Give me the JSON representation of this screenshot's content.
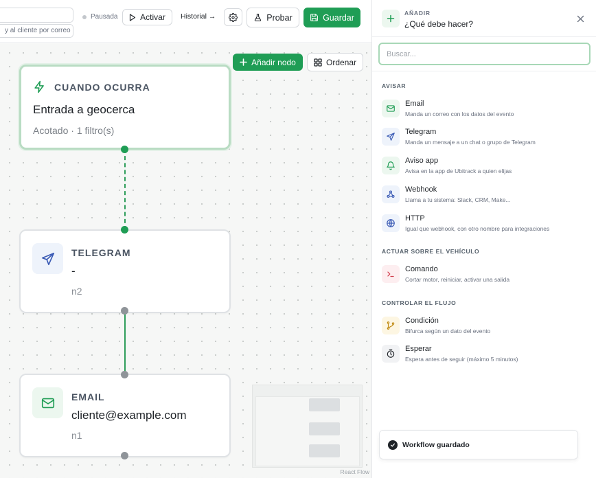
{
  "header": {
    "description_text": "y al cliente por correo",
    "status_label": "Pausada",
    "activate_label": "Activar",
    "history_label": "Historial →",
    "test_label": "Probar",
    "save_label": "Guardar"
  },
  "canvas": {
    "add_node_label": "Añadir nodo",
    "sort_label": "Ordenar",
    "attribution": "React Flow",
    "trigger": {
      "kicker": "CUANDO OCURRA",
      "title": "Entrada a geocerca",
      "subtitle": "Acotado · 1 filtro(s)"
    },
    "nodes": [
      {
        "type": "TELEGRAM",
        "value": "-",
        "id": "n2",
        "icon": "send-icon"
      },
      {
        "type": "EMAIL",
        "value": "cliente@example.com",
        "id": "n1",
        "icon": "mail-icon"
      }
    ]
  },
  "panel": {
    "kicker": "AÑADIR",
    "title": "¿Qué debe hacer?",
    "search_placeholder": "Buscar...",
    "sections": [
      {
        "title": "AVISAR",
        "items": [
          {
            "title": "Email",
            "desc": "Manda un correo con los datos del evento",
            "icon": "mail-icon"
          },
          {
            "title": "Telegram",
            "desc": "Manda un mensaje a un chat o grupo de Telegram",
            "icon": "send-icon"
          },
          {
            "title": "Aviso app",
            "desc": "Avisa en la app de Ubitrack a quien elijas",
            "icon": "bell-icon"
          },
          {
            "title": "Webhook",
            "desc": "Llama a tu sistema: Slack, CRM, Make...",
            "icon": "webhook-icon"
          },
          {
            "title": "HTTP",
            "desc": "Igual que webhook, con otro nombre para integraciones",
            "icon": "globe-icon"
          }
        ]
      },
      {
        "title": "ACTUAR SOBRE EL VEHÍCULO",
        "items": [
          {
            "title": "Comando",
            "desc": "Cortar motor, reiniciar, activar una salida",
            "icon": "terminal-icon"
          }
        ]
      },
      {
        "title": "CONTROLAR EL FLUJO",
        "items": [
          {
            "title": "Condición",
            "desc": "Bifurca según un dato del evento",
            "icon": "branch-icon"
          },
          {
            "title": "Esperar",
            "desc": "Espera antes de seguir (máximo 5 minutos)",
            "icon": "timer-icon"
          }
        ]
      }
    ]
  },
  "toast": {
    "text": "Workflow guardado"
  }
}
